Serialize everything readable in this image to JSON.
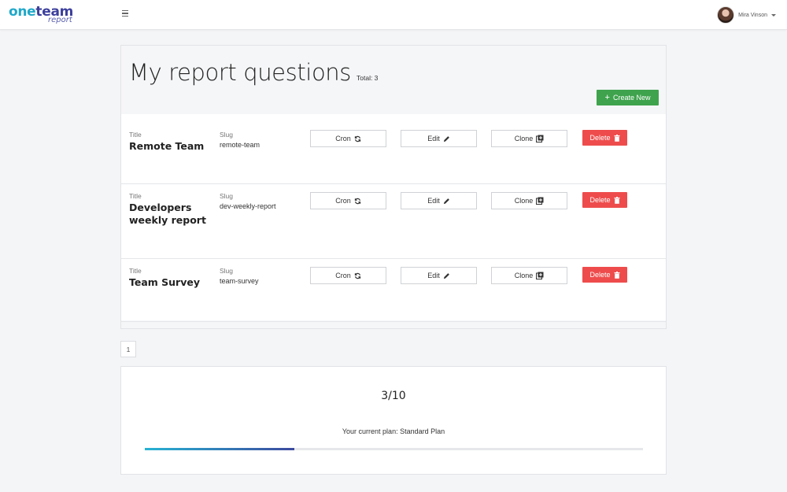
{
  "header": {
    "logo_main_1": "one",
    "logo_main_2": "team",
    "logo_sub": "report",
    "user_name": "Mira Vinson"
  },
  "page": {
    "title": "My report questions",
    "total": "Total: 3",
    "create_label": "Create New"
  },
  "table": {
    "title_label": "Title",
    "slug_label": "Slug",
    "rows": [
      {
        "title": "Remote Team",
        "slug": "remote-team"
      },
      {
        "title": "Developers weekly report",
        "slug": "dev-weekly-report"
      },
      {
        "title": "Team Survey",
        "slug": "team-survey"
      }
    ],
    "actions": {
      "cron": "Cron",
      "edit": "Edit",
      "clone": "Clone",
      "delete": "Delete"
    }
  },
  "pagination": {
    "current": "1"
  },
  "plan": {
    "count": "3/10",
    "used": 3,
    "limit": 10,
    "text": "Your current plan: Standard Plan"
  },
  "colors": {
    "brand_cyan": "#1fa8c9",
    "brand_indigo": "#3c3f9c",
    "create_green": "#3fa34d",
    "delete_red": "#ee4c4c"
  },
  "icons": {
    "menu": "hamburger-icon",
    "cron": "refresh-icon",
    "edit": "pencil-icon",
    "clone": "clone-plus-icon",
    "delete": "trash-icon",
    "user_menu": "caret-down-icon"
  }
}
